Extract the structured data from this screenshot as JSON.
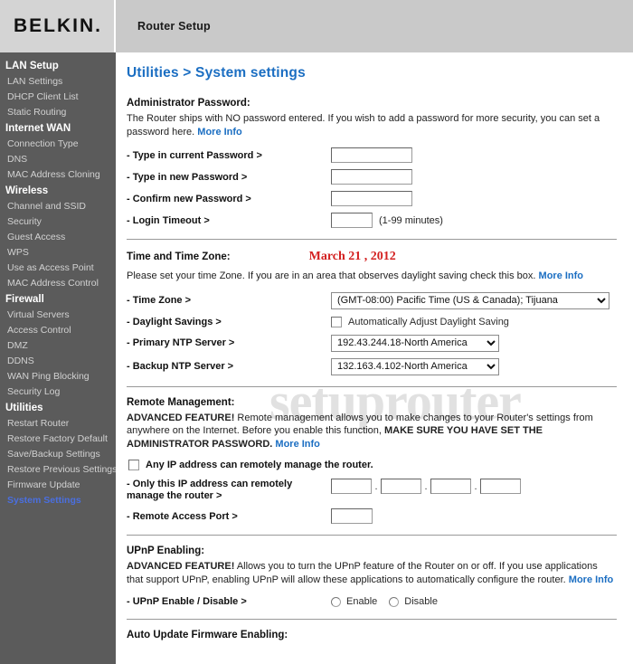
{
  "header": {
    "logo": "BELKIN",
    "logo_dot": ".",
    "title": "Router Setup"
  },
  "watermark": "setuprouter",
  "sidebar": {
    "groups": [
      {
        "label": "LAN Setup",
        "items": [
          {
            "label": "LAN Settings",
            "active": false
          },
          {
            "label": "DHCP Client List",
            "active": false
          },
          {
            "label": "Static Routing",
            "active": false
          }
        ]
      },
      {
        "label": "Internet WAN",
        "items": [
          {
            "label": "Connection Type",
            "active": false
          },
          {
            "label": "DNS",
            "active": false
          },
          {
            "label": "MAC Address Cloning",
            "active": false
          }
        ]
      },
      {
        "label": "Wireless",
        "items": [
          {
            "label": "Channel and SSID",
            "active": false
          },
          {
            "label": "Security",
            "active": false
          },
          {
            "label": "Guest Access",
            "active": false
          },
          {
            "label": "WPS",
            "active": false
          },
          {
            "label": "Use as Access Point",
            "active": false
          },
          {
            "label": "MAC Address Control",
            "active": false
          }
        ]
      },
      {
        "label": "Firewall",
        "items": [
          {
            "label": "Virtual Servers",
            "active": false
          },
          {
            "label": "Access Control",
            "active": false
          },
          {
            "label": "DMZ",
            "active": false
          },
          {
            "label": "DDNS",
            "active": false
          },
          {
            "label": "WAN Ping Blocking",
            "active": false
          },
          {
            "label": "Security Log",
            "active": false
          }
        ]
      },
      {
        "label": "Utilities",
        "items": [
          {
            "label": "Restart Router",
            "active": false
          },
          {
            "label": "Restore Factory Default",
            "active": false
          },
          {
            "label": "Save/Backup Settings",
            "active": false
          },
          {
            "label": "Restore Previous Settings",
            "active": false
          },
          {
            "label": "Firmware Update",
            "active": false
          },
          {
            "label": "System Settings",
            "active": true
          }
        ]
      }
    ]
  },
  "main": {
    "page_title": "Utilities > System settings",
    "admin_password": {
      "heading": "Administrator Password:",
      "description": "The Router ships with NO password entered. If you wish to add a password for more security, you can set a password here.",
      "more_info": "More Info",
      "fields": [
        {
          "label": "- Type in current Password >",
          "value": "",
          "type": "password"
        },
        {
          "label": "- Type in new Password >",
          "value": "",
          "type": "password"
        },
        {
          "label": "- Confirm new Password >",
          "value": "",
          "type": "password"
        }
      ],
      "login_timeout": {
        "label": "- Login Timeout >",
        "value": "",
        "hint": "(1-99 minutes)"
      }
    },
    "time_zone": {
      "heading": "Time and Time Zone:",
      "date": "March 21 , 2012",
      "description": "Please set your time Zone. If you are in an area that observes daylight saving check this box.",
      "more_info": "More Info",
      "timezone_label": "- Time Zone >",
      "timezone_value": "(GMT-08:00) Pacific Time (US & Canada); Tijuana",
      "daylight_label": "- Daylight Savings >",
      "daylight_checkbox_label": "Automatically Adjust Daylight Saving",
      "daylight_checked": false,
      "primary_ntp_label": "- Primary NTP Server >",
      "primary_ntp_value": "192.43.244.18-North America",
      "backup_ntp_label": "- Backup NTP Server >",
      "backup_ntp_value": "132.163.4.102-North America"
    },
    "remote_management": {
      "heading": "Remote Management:",
      "advanced_tag": "ADVANCED FEATURE!",
      "desc_part1": " Remote management allows you to make changes to your Router's settings from anywhere on the Internet. Before you enable this function, ",
      "desc_bold": "MAKE SURE YOU HAVE SET THE ADMINISTRATOR PASSWORD.",
      "more_info": "More Info",
      "any_ip_label": "Any IP address can remotely manage the router.",
      "any_ip_checked": false,
      "only_ip_label": "- Only this IP address can remotely manage the router >",
      "ip_octets": [
        "",
        "",
        "",
        ""
      ],
      "port_label": "- Remote Access Port >",
      "port_value": ""
    },
    "upnp": {
      "heading": "UPnP Enabling:",
      "advanced_tag": "ADVANCED FEATURE!",
      "desc_part1": " Allows you to turn the UPnP feature of the Router on or off. If you use applications that support UPnP, enabling UPnP will allow these applications to automatically configure the router. ",
      "more_info": "More Info",
      "toggle_label": "- UPnP Enable / Disable >",
      "enable_label": "Enable",
      "disable_label": "Disable",
      "selected": ""
    },
    "auto_update": {
      "heading": "Auto Update Firmware Enabling:"
    }
  },
  "colors": {
    "link": "#1b6ec2",
    "date_red": "#d32020",
    "sidebar_bg": "#5b5b5b",
    "header_bg": "#c9c9c9",
    "active_nav": "#4a6fe0"
  }
}
